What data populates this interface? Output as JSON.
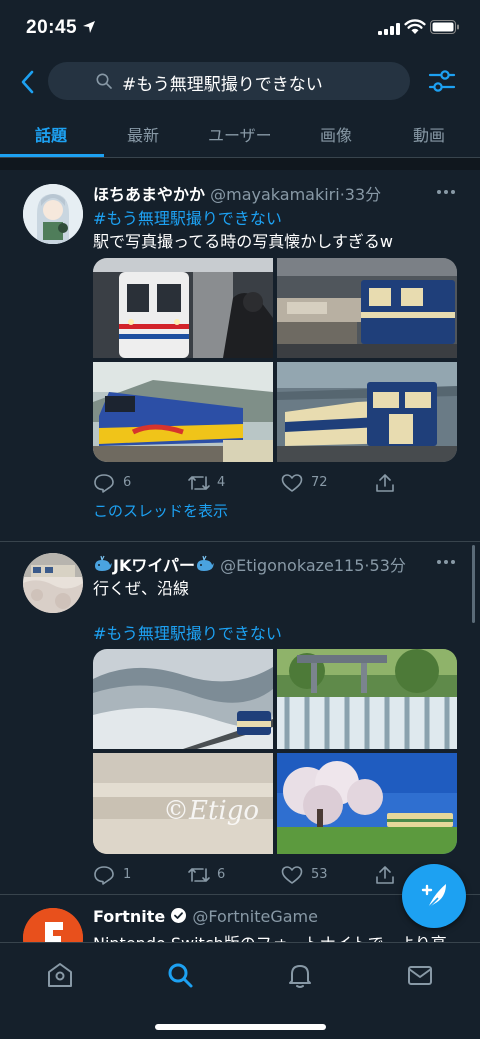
{
  "status_bar": {
    "time": "20:45"
  },
  "search": {
    "query": "#もう無理駅撮りできない"
  },
  "tabs": [
    {
      "label": "話題",
      "active": true
    },
    {
      "label": "最新"
    },
    {
      "label": "ユーザー"
    },
    {
      "label": "画像"
    },
    {
      "label": "動画"
    }
  ],
  "tweets": [
    {
      "name": "ほちあまやかか",
      "handle": "@mayakamakiri",
      "time": "33分",
      "hashtag": "#もう無理駅撮りできない",
      "text": "駅で写真撮ってる時の写真懐かしすぎるw",
      "replies": "6",
      "retweets": "4",
      "likes": "72",
      "thread_link": "このスレッドを表示"
    },
    {
      "name": "JKワイパー",
      "handle": "@Etigonokaze115",
      "time": "53分",
      "text": "行くぜ、沿線",
      "hashtag": "#もう無理駅撮りできない",
      "watermark": "©Etigo",
      "replies": "1",
      "retweets": "6",
      "likes": "53"
    },
    {
      "name": "Fortnite",
      "handle": "@FortniteGame",
      "text": "Nintendo Switch版のフォートナイトで、より高"
    }
  ],
  "colors": {
    "background": "#15202b",
    "accent": "#1da1f2",
    "secondary_text": "#8899a6",
    "divider": "#38444d"
  }
}
